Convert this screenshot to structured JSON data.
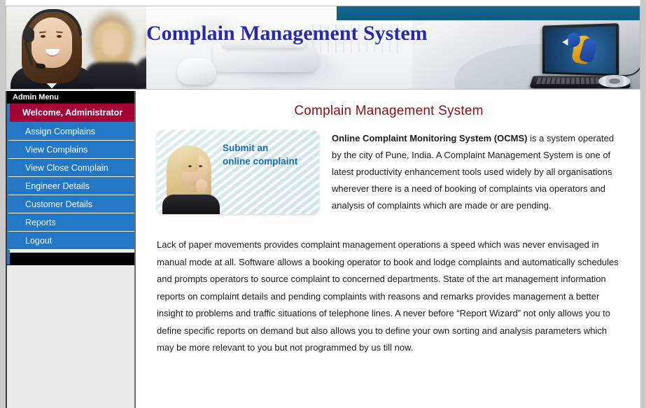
{
  "header": {
    "title": "Complain Management System",
    "left_photo_alt": "call-center-operator-photo",
    "right_photo_alt": "laptop-with-parrot-wallpaper-photo"
  },
  "sidebar": {
    "menu_header": "Admin Menu",
    "items": [
      {
        "label": "Welcome, Administrator",
        "state": "active"
      },
      {
        "label": "Assign Complains",
        "state": "normal"
      },
      {
        "label": "View Complains",
        "state": "normal"
      },
      {
        "label": "View Close Complain",
        "state": "normal"
      },
      {
        "label": "Engineer Details",
        "state": "normal"
      },
      {
        "label": "Customer Details",
        "state": "normal"
      },
      {
        "label": "Reports",
        "state": "normal"
      },
      {
        "label": "Logout",
        "state": "normal"
      }
    ]
  },
  "main": {
    "page_title": "Complain Management System",
    "promo": {
      "line1": "Submit an",
      "line2": "online complaint"
    },
    "intro_bold": "Online Complaint Monitoring System (OCMS)",
    "intro_rest": " is a system operated by the city of Pune, India. A Complaint Management System is one of latest productivity enhancement tools used widely by all organisations wherever there is a need of booking of complaints via operators and analysis of complaints which are made or are pending.",
    "body_paragraph": "Lack of paper movements provides complaint management operations a speed which was never envisaged in manual mode at all. Software allows a booking operator to book and lodge complaints and automatically schedules and prompts operators to source complaint to concerned departments. State of the art management information reports on complaint details and pending complaints with reasons and remarks provides management a better insight to problems and traffic situations of telephone lines. A never before “Report Wizard” not only allows you to define specific reports on demand but also allows you to define your own sorting and analysis parameters which may be more relevant to you but not programmed by us till now."
  },
  "colors": {
    "menu_blue": "#2377c4",
    "menu_active_maroon": "#a50336",
    "menu_header_black": "#000000",
    "title_blue": "#2727b7",
    "page_title_maroon": "#8c0f14",
    "promo_text_blue": "#1a6ea8",
    "teal_bar": "#0f5c82",
    "sidebar_bg": "#eaeaea"
  }
}
